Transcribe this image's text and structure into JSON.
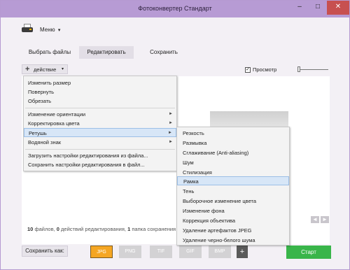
{
  "window": {
    "title": "Фотоконвертер Стандарт",
    "min": "–",
    "max": "□",
    "close": "✕"
  },
  "header": {
    "menu_label": "Меню",
    "menu_arrow": "▾"
  },
  "tabs": [
    {
      "label": "Выбрать файлы"
    },
    {
      "label": "Редактировать"
    },
    {
      "label": "Сохранить"
    }
  ],
  "toolbar": {
    "action_label": "действие",
    "plus": "+",
    "arrow": "▾",
    "preview_label": "Просмотр",
    "preview_checked": true,
    "check": "✓"
  },
  "action_menu": {
    "items": [
      {
        "label": "Изменить размер"
      },
      {
        "label": "Повернуть"
      },
      {
        "label": "Обрезать"
      },
      {
        "label": "Изменение ориентации",
        "arrow": "►"
      },
      {
        "label": "Корректировка цвета",
        "arrow": "►"
      },
      {
        "label": "Ретушь",
        "arrow": "►"
      },
      {
        "label": "Водяной знак",
        "arrow": "►"
      },
      {
        "label": "Загрузить настройки редактирования из файла..."
      },
      {
        "label": "Сохранить настройки редактирования в файл..."
      }
    ]
  },
  "retouch_menu": {
    "items": [
      {
        "label": "Резкость"
      },
      {
        "label": "Размывка"
      },
      {
        "label": "Сглаживание (Anti-aliasing)"
      },
      {
        "label": "Шум"
      },
      {
        "label": "Стилизация"
      },
      {
        "label": "Рамка"
      },
      {
        "label": "Тень"
      },
      {
        "label": "Выборочное изменение цвета"
      },
      {
        "label": "Изменение фона"
      },
      {
        "label": "Коррекция объектива"
      },
      {
        "label": "Удаление артефактов JPEG"
      },
      {
        "label": "Удаление черно-белого шума"
      }
    ]
  },
  "nav": {
    "prev": "◄",
    "next": "►"
  },
  "status": {
    "files_count": "10",
    "files_label": "файлов,",
    "actions_count": "0",
    "actions_label": "действий редактирования,",
    "folders_count": "1",
    "folders_label": "папка сохранения"
  },
  "footer": {
    "save_as_label": "Сохранить как:",
    "formats": [
      {
        "label": "JPG",
        "selected": true
      },
      {
        "label": "PNG"
      },
      {
        "label": "TIF"
      },
      {
        "label": "GIF"
      },
      {
        "label": "BMP"
      }
    ],
    "add_format": "+",
    "start_label": "Старт"
  },
  "colors": {
    "titlebar": "#b79bd4",
    "accent_format": "#f5a623",
    "start_button": "#39b54a",
    "highlight": "#d7e6f7"
  }
}
